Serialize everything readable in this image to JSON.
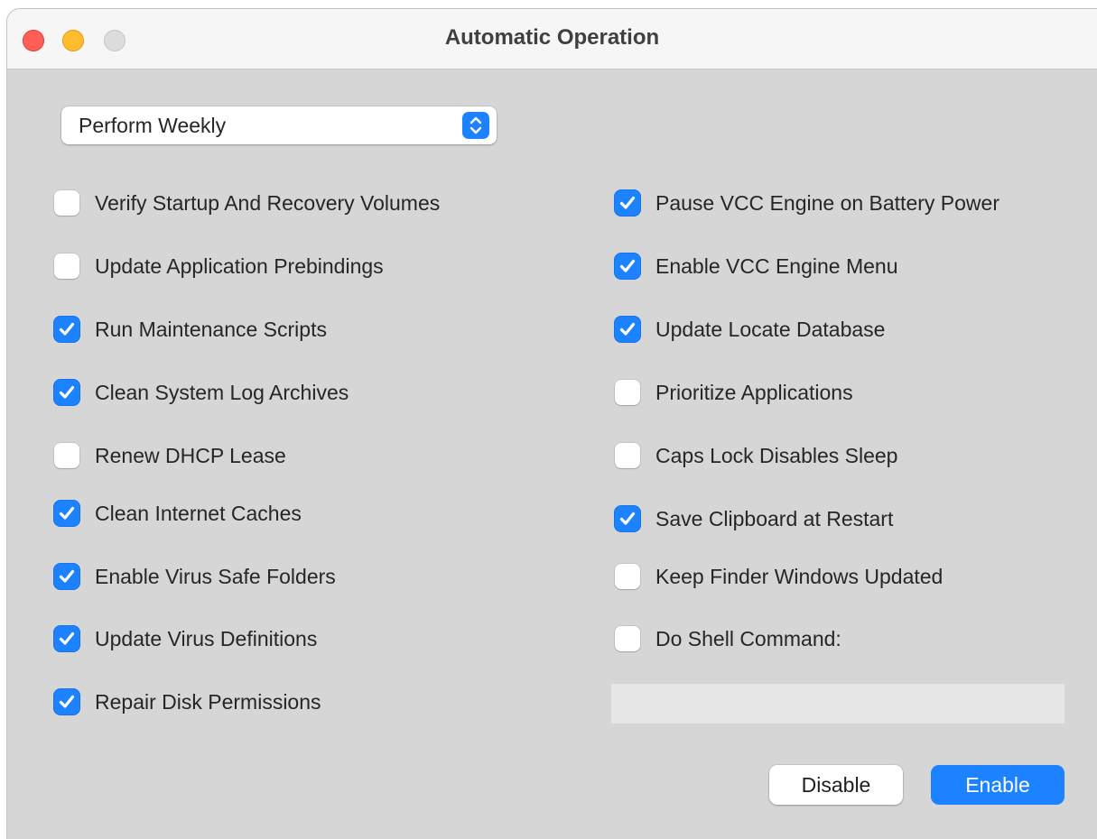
{
  "window": {
    "title": "Automatic Operation"
  },
  "schedule": {
    "selected": "Perform Weekly"
  },
  "left_options": [
    {
      "label": "Verify Startup And Recovery Volumes",
      "checked": false
    },
    {
      "label": "Update Application Prebindings",
      "checked": false
    },
    {
      "label": "Run Maintenance Scripts",
      "checked": true
    },
    {
      "label": "Clean System Log Archives",
      "checked": true
    },
    {
      "label": "Renew DHCP Lease",
      "checked": false
    },
    {
      "label": "Clean Internet Caches",
      "checked": true
    },
    {
      "label": "Enable Virus Safe Folders",
      "checked": true
    },
    {
      "label": "Update Virus Definitions",
      "checked": true
    },
    {
      "label": "Repair Disk Permissions",
      "checked": true
    }
  ],
  "right_options": [
    {
      "label": "Pause VCC Engine on Battery Power",
      "checked": true
    },
    {
      "label": "Enable VCC Engine Menu",
      "checked": true
    },
    {
      "label": "Update Locate Database",
      "checked": true
    },
    {
      "label": "Prioritize Applications",
      "checked": false
    },
    {
      "label": "Caps Lock Disables Sleep",
      "checked": false
    },
    {
      "label": "Save Clipboard at Restart",
      "checked": true
    },
    {
      "label": "Keep Finder Windows Updated",
      "checked": false
    },
    {
      "label": "Do Shell Command:",
      "checked": false
    }
  ],
  "shell_command": {
    "value": ""
  },
  "buttons": {
    "disable_label": "Disable",
    "enable_label": "Enable"
  },
  "colors": {
    "accent": "#1c82ff",
    "close": "#ff5f57",
    "minimize": "#febc2e",
    "zoom_inactive": "#dcdcdc",
    "panel": "#d6d6d6"
  }
}
